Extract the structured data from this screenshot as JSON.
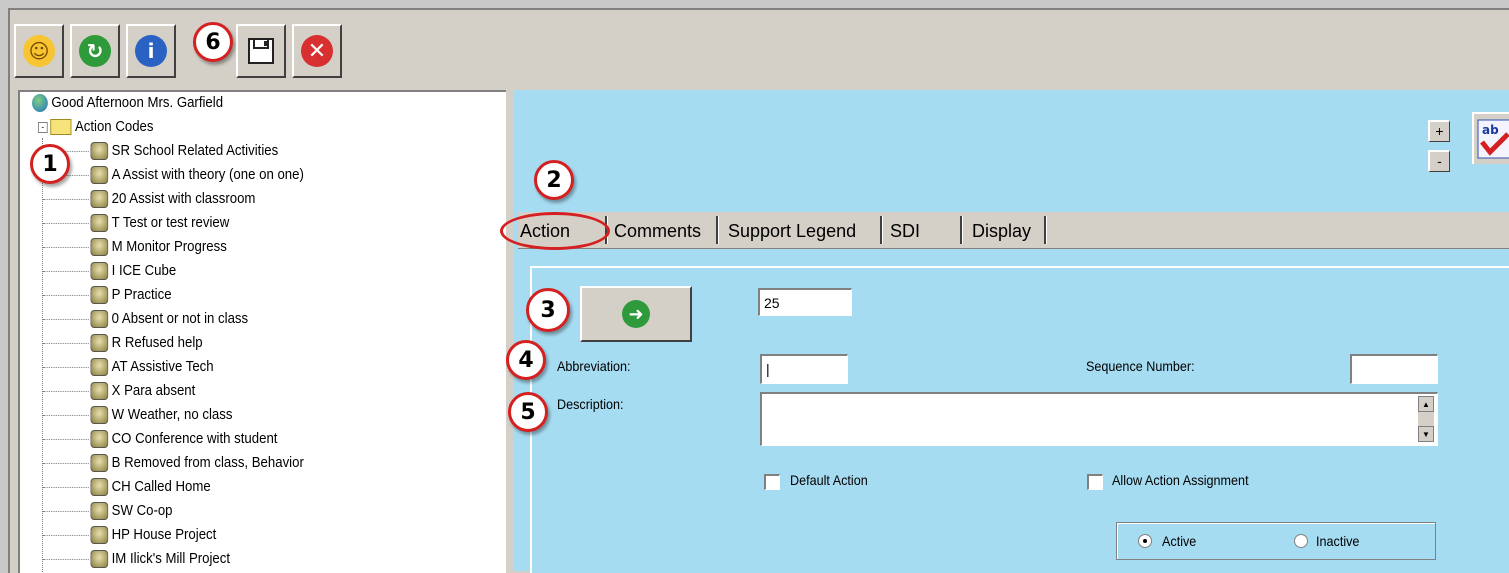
{
  "toolbar": {
    "buttons": [
      {
        "name": "smiley-icon"
      },
      {
        "name": "refresh-icon"
      },
      {
        "name": "info-icon"
      },
      {
        "name": "save-icon"
      },
      {
        "name": "close-icon"
      }
    ],
    "callout_label": "6"
  },
  "tree": {
    "greeting": "Good Afternoon Mrs. Garfield",
    "folder": "Action Codes",
    "expander": "-",
    "items": [
      "SR School Related Activities",
      "A Assist with theory (one on one)",
      "20 Assist with classroom",
      "T Test or test review",
      "M Monitor Progress",
      "I ICE Cube",
      "P Practice",
      "0 Absent or not in class",
      "R Refused help",
      "AT Assistive Tech",
      "X Para absent",
      "W Weather, no class",
      "CO Conference with student",
      "B Removed from class, Behavior",
      "CH Called Home",
      "SW Co-op",
      "HP House Project",
      "IM Ilick's Mill Project"
    ]
  },
  "tabs": [
    "Action",
    "Comments",
    "Support Legend",
    "SDI",
    "Display"
  ],
  "form": {
    "id_value": "25",
    "abbreviation_label": "Abbreviation:",
    "abbreviation_value": "|",
    "sequence_label": "Sequence Number:",
    "sequence_value": "",
    "description_label": "Description:",
    "description_value": "",
    "default_action_label": "Default Action",
    "allow_assignment_label": "Allow Action Assignment",
    "active_label": "Active",
    "inactive_label": "Inactive",
    "status_selected": "Active"
  },
  "zoom": {
    "plus": "+",
    "minus": "-"
  },
  "spell_label": "ab",
  "callouts": [
    "1",
    "2",
    "3",
    "4",
    "5",
    "6"
  ],
  "colors": {
    "panel_blue": "#a6dcf2",
    "callout_red": "#d42020",
    "window_gray": "#d4d0c8"
  }
}
